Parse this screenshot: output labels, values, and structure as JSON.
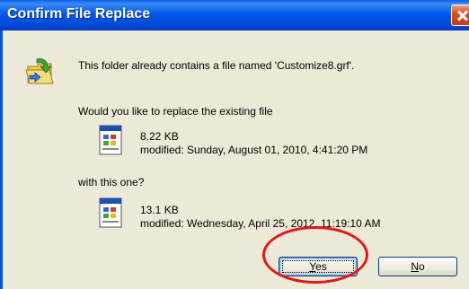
{
  "window": {
    "title": "Confirm File Replace",
    "close_icon": "close-icon"
  },
  "message": {
    "line1": "This folder already contains a file named 'Customize8.grf'.",
    "question": "Would you like to replace the existing file",
    "with_this": "with this one?"
  },
  "existing_file": {
    "size": "8.22 KB",
    "modified": "modified: Sunday, August 01, 2010, 4:41:20 PM"
  },
  "new_file": {
    "size": "13.1 KB",
    "modified": "modified: Wednesday, April 25, 2012, 11:19:10 AM"
  },
  "buttons": {
    "yes_prefix": "",
    "yes_mnemonic": "Y",
    "yes_rest": "es",
    "no_mnemonic": "N",
    "no_rest": "o"
  },
  "annotation": {
    "color": "#e01818"
  },
  "icons": [
    "folder-move-icon",
    "file-icon"
  ]
}
